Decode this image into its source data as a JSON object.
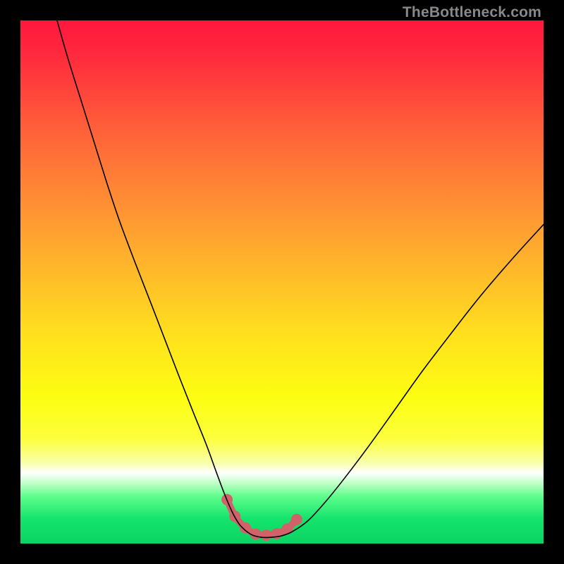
{
  "watermark": "TheBottleneck.com",
  "chart_data": {
    "type": "line",
    "title": "",
    "xlabel": "",
    "ylabel": "",
    "xlim": [
      0,
      100
    ],
    "ylim": [
      0,
      100
    ],
    "gradient_stops": [
      {
        "offset": 0.0,
        "color": "#ff173e"
      },
      {
        "offset": 0.07,
        "color": "#ff2b3d"
      },
      {
        "offset": 0.2,
        "color": "#ff5d3a"
      },
      {
        "offset": 0.35,
        "color": "#ff8f34"
      },
      {
        "offset": 0.48,
        "color": "#ffb92a"
      },
      {
        "offset": 0.6,
        "color": "#ffe01e"
      },
      {
        "offset": 0.72,
        "color": "#fdfd11"
      },
      {
        "offset": 0.8,
        "color": "#fcff3c"
      },
      {
        "offset": 0.845,
        "color": "#f8ffa8"
      },
      {
        "offset": 0.865,
        "color": "#ffffff"
      },
      {
        "offset": 0.885,
        "color": "#bfffc6"
      },
      {
        "offset": 0.91,
        "color": "#5dfd8b"
      },
      {
        "offset": 0.952,
        "color": "#15e46c"
      },
      {
        "offset": 1.0,
        "color": "#0bd364"
      }
    ],
    "series": [
      {
        "name": "bottleneck-curve",
        "color": "#000000",
        "width": 1.6,
        "x": [
          7.0,
          9.0,
          11.5,
          14.0,
          16.5,
          19.0,
          22.0,
          25.0,
          28.0,
          30.5,
          33.0,
          35.5,
          37.5,
          39.0,
          40.5,
          42.0,
          44.0,
          46.0,
          48.0,
          50.0,
          52.0,
          55.0,
          58.5,
          62.5,
          67.0,
          72.0,
          77.0,
          82.5,
          88.0,
          94.0,
          100.0
        ],
        "y": [
          100.0,
          93.0,
          85.0,
          77.0,
          69.0,
          61.5,
          53.5,
          45.8,
          38.0,
          31.5,
          25.2,
          19.0,
          13.5,
          9.5,
          6.0,
          3.5,
          1.8,
          1.2,
          1.2,
          1.5,
          2.3,
          4.4,
          8.2,
          13.2,
          19.2,
          26.2,
          33.2,
          40.4,
          47.4,
          54.4,
          61.0
        ]
      },
      {
        "name": "bottom-marker",
        "color": "#d1626a",
        "type": "scatter_line",
        "marker_radius": 8,
        "line_width": 10,
        "x": [
          39.5,
          41.0,
          43.0,
          45.0,
          47.0,
          49.0,
          51.0,
          52.8
        ],
        "y": [
          8.4,
          5.2,
          3.0,
          1.8,
          1.6,
          1.9,
          2.8,
          4.6
        ]
      }
    ]
  }
}
